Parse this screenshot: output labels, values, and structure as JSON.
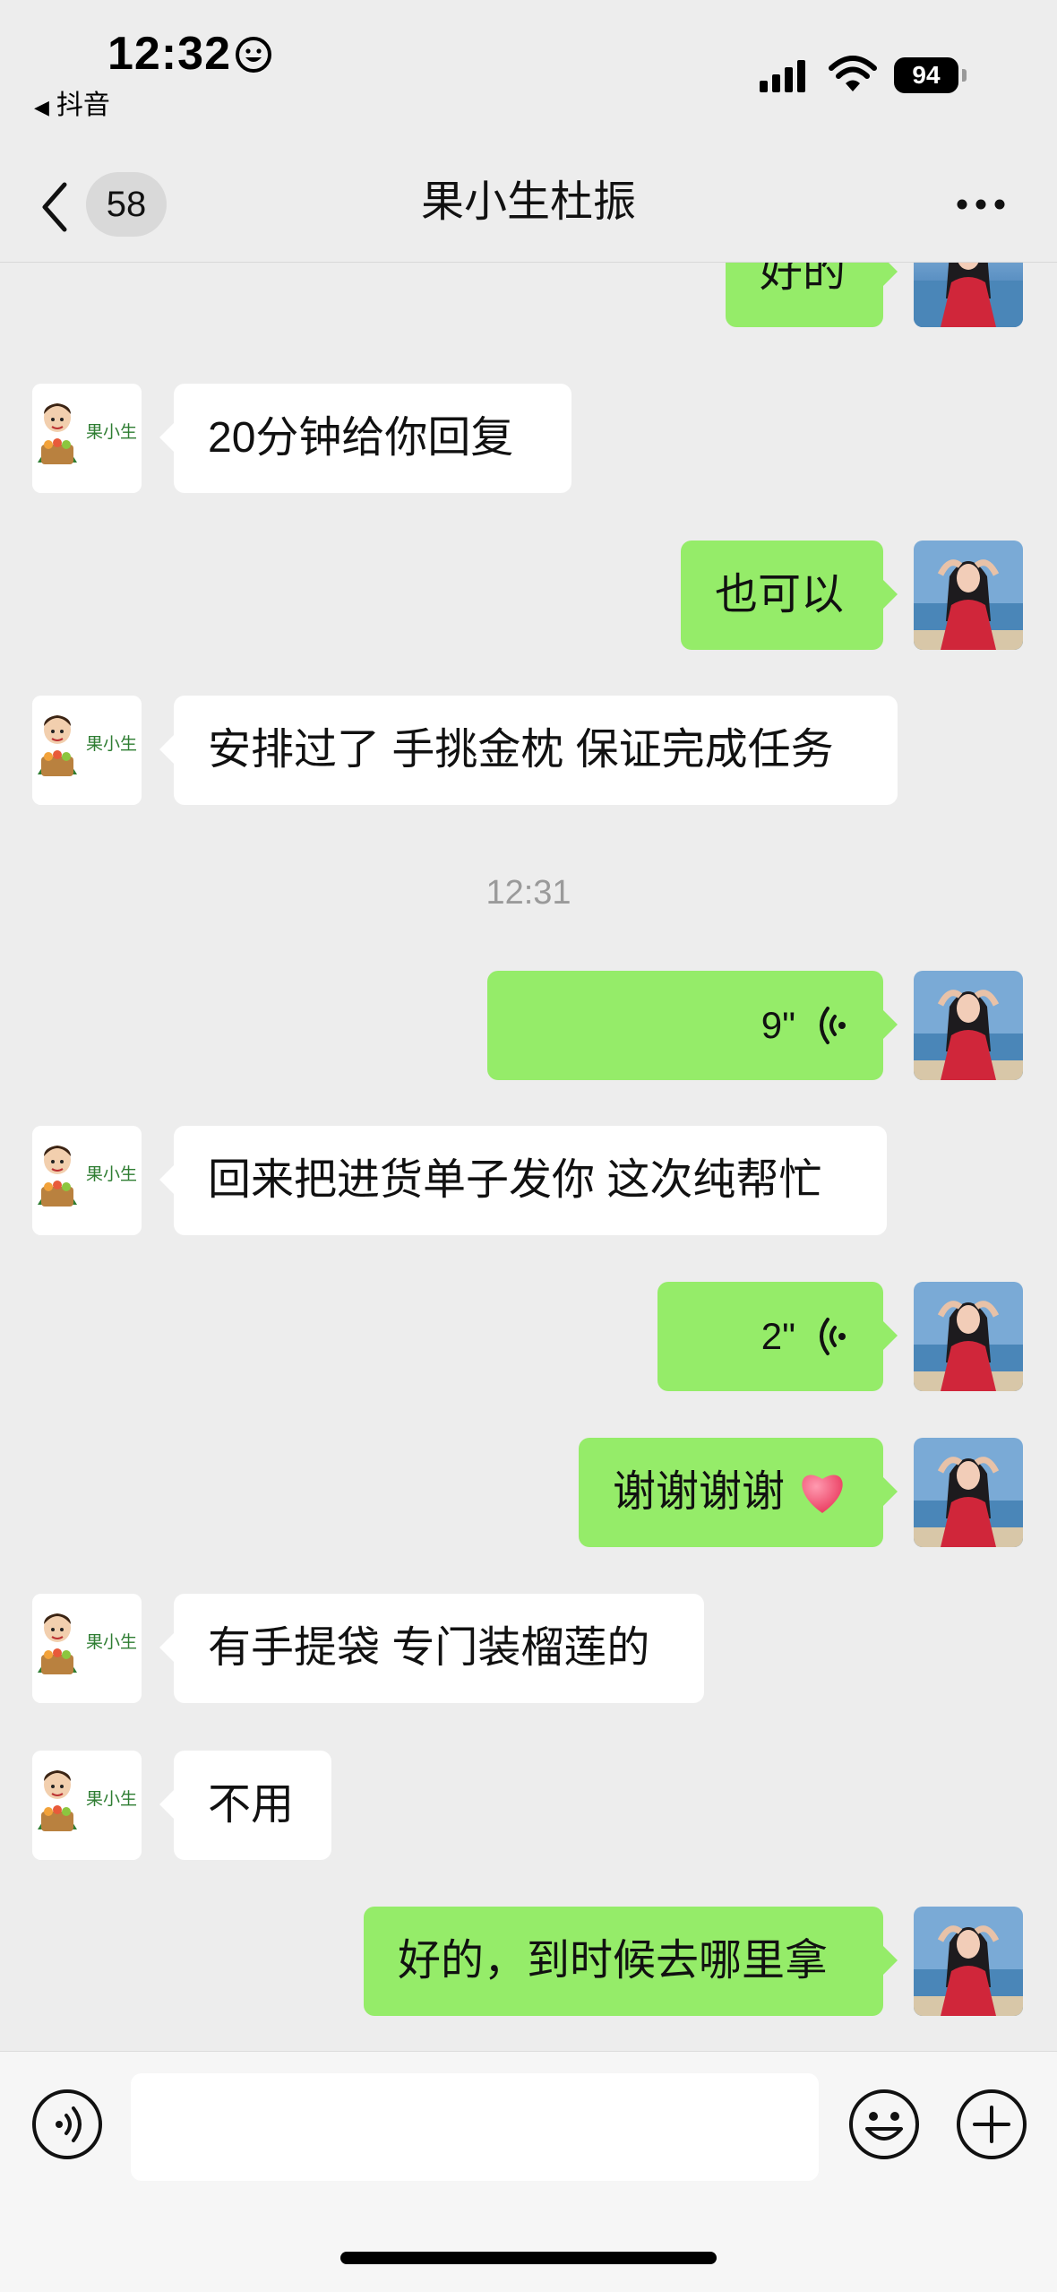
{
  "status_bar": {
    "time": "12:32",
    "back_app": "抖音",
    "battery": "94"
  },
  "nav": {
    "unread_count": "58",
    "title": "果小生杜振"
  },
  "avatar_label": "果小生",
  "messages": [
    {
      "side": "right",
      "text": "好的"
    },
    {
      "side": "left",
      "text": "20分钟给你回复"
    },
    {
      "side": "right",
      "text": "也可以"
    },
    {
      "side": "left",
      "text": "安排过了 手挑金枕 保证完成任务"
    },
    {
      "type": "time",
      "text": "12:31"
    },
    {
      "side": "right",
      "voice": "9\""
    },
    {
      "side": "left",
      "text": "回来把进货单子发你 这次纯帮忙"
    },
    {
      "side": "right",
      "voice": "2\""
    },
    {
      "side": "right",
      "text": "谢谢谢谢"
    },
    {
      "side": "left",
      "text": "有手提袋 专门装榴莲的"
    },
    {
      "side": "left",
      "text": "不用"
    },
    {
      "side": "right",
      "text": "好的，到时候去哪里拿"
    }
  ],
  "input": {
    "value": ""
  }
}
